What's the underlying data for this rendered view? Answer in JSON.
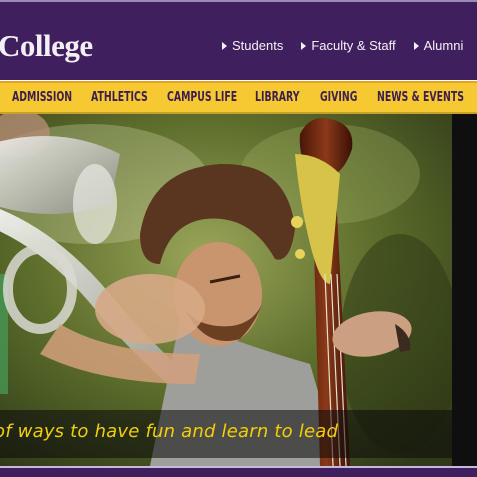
{
  "header": {
    "logo_text": "College",
    "links": [
      {
        "label": "Students"
      },
      {
        "label": "Faculty & Staff"
      },
      {
        "label": "Alumni"
      }
    ]
  },
  "nav": {
    "items": [
      {
        "label": "ADMISSION"
      },
      {
        "label": "ATHLETICS"
      },
      {
        "label": "CAMPUS LIFE"
      },
      {
        "label": "LIBRARY"
      },
      {
        "label": "GIVING"
      },
      {
        "label": "NEWS & EVENTS"
      }
    ]
  },
  "hero": {
    "caption": "of ways to have fun and learn to lead"
  },
  "colors": {
    "brand_purple": "#3f1f5e",
    "nav_gold": "#f6c832",
    "caption_yellow": "#f4d000"
  }
}
